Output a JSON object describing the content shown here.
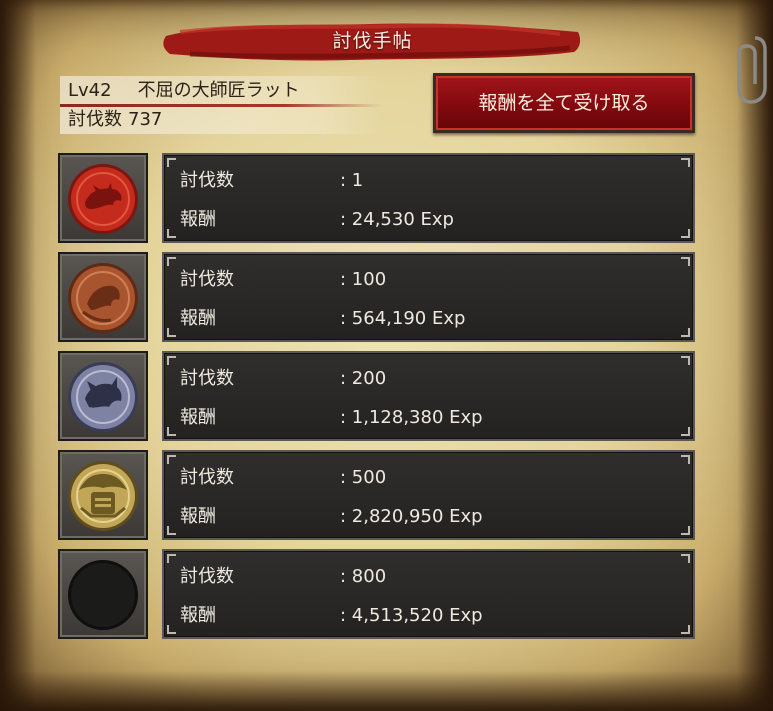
{
  "title": "討伐手帖",
  "player": {
    "level": "Lv42",
    "name": "不屈の大師匠ラット",
    "kills_label": "討伐数",
    "kills_value": "737"
  },
  "claim_all_label": "報酬を全て受け取る",
  "rows": [
    {
      "kills_label": "討伐数",
      "kills": ": 1",
      "reward_label": "報酬",
      "reward": ": 24,530 Exp",
      "medal": "red-beast-medal-icon",
      "medal_color": "#c42b1c"
    },
    {
      "kills_label": "討伐数",
      "kills": ": 100",
      "reward_label": "報酬",
      "reward": ": 564,190 Exp",
      "medal": "bronze-beast-medal-icon",
      "medal_color": "#a8542f"
    },
    {
      "kills_label": "討伐数",
      "kills": ": 200",
      "reward_label": "報酬",
      "reward": ": 1,128,380 Exp",
      "medal": "silver-beast-medal-icon",
      "medal_color": "#7e82a3"
    },
    {
      "kills_label": "討伐数",
      "kills": ": 500",
      "reward_label": "報酬",
      "reward": ": 2,820,950 Exp",
      "medal": "gold-helmet-medal-icon",
      "medal_color": "#c2a658"
    },
    {
      "kills_label": "討伐数",
      "kills": ": 800",
      "reward_label": "報酬",
      "reward": ": 4,513,520 Exp",
      "medal": "locked-medal-icon",
      "medal_color": "#1b1b1a"
    }
  ]
}
